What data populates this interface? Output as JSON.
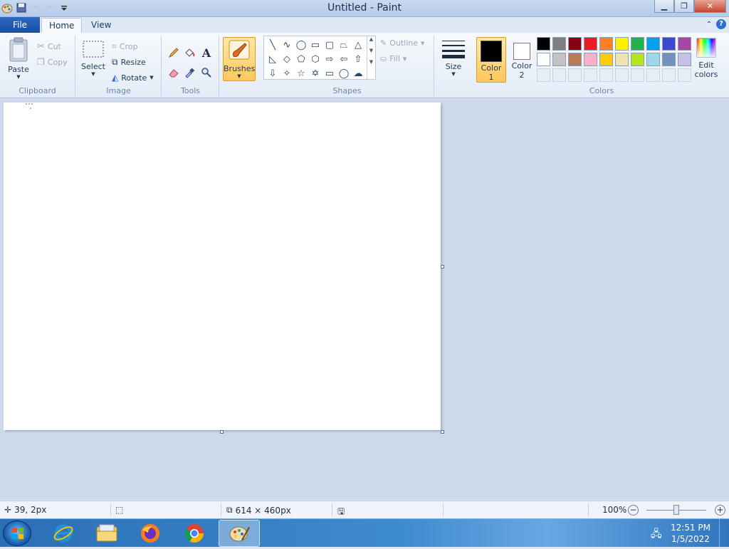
{
  "window": {
    "title": "Untitled - Paint"
  },
  "tabs": {
    "file": "File",
    "home": "Home",
    "view": "View"
  },
  "clipboard": {
    "paste": "Paste",
    "cut": "Cut",
    "copy": "Copy",
    "label": "Clipboard"
  },
  "image": {
    "select": "Select",
    "crop": "Crop",
    "resize": "Resize",
    "rotate": "Rotate",
    "label": "Image"
  },
  "tools": {
    "label": "Tools"
  },
  "brushes": {
    "label": "Brushes"
  },
  "shapes": {
    "outline": "Outline",
    "fill": "Fill",
    "label": "Shapes"
  },
  "size": {
    "label": "Size"
  },
  "colors": {
    "color1_line1": "Color",
    "color1_line2": "1",
    "color2_line1": "Color",
    "color2_line2": "2",
    "edit_line1": "Edit",
    "edit_line2": "colors",
    "label": "Colors",
    "color1_value": "#000000",
    "color2_value": "#ffffff",
    "palette_row1": [
      "#000000",
      "#7f7f7f",
      "#880015",
      "#ed1c24",
      "#ff7f27",
      "#fff200",
      "#22b14c",
      "#00a2e8",
      "#3f48cc",
      "#a349a4"
    ],
    "palette_row2": [
      "#ffffff",
      "#c3c3c3",
      "#b97a57",
      "#ffaec9",
      "#ffc90e",
      "#efe4b0",
      "#b5e61d",
      "#99d9ea",
      "#7092be",
      "#c8bfe7"
    ]
  },
  "status": {
    "cursor_pos": "39, 2px",
    "canvas_size": "614 × 460px",
    "zoom": "100%"
  },
  "taskbar": {
    "time": "12:51 PM",
    "date": "1/5/2022"
  }
}
